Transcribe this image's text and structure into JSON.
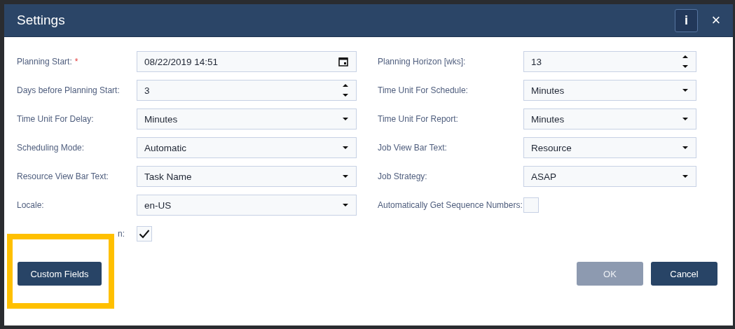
{
  "window": {
    "title": "Settings",
    "info_button": "i",
    "close_button": "×"
  },
  "left_fields": [
    {
      "label": "Planning Start:",
      "required_mark": "*",
      "kind": "date",
      "value": "08/22/2019 14:51"
    },
    {
      "label": "Days before Planning Start:",
      "kind": "number",
      "value": "3"
    },
    {
      "label": "Time Unit For Delay:",
      "kind": "select",
      "value": "Minutes"
    },
    {
      "label": "Scheduling Mode:",
      "kind": "select",
      "value": "Automatic"
    },
    {
      "label": "Resource View Bar Text:",
      "kind": "select",
      "value": "Task Name"
    },
    {
      "label": "Locale:",
      "kind": "select",
      "value": "en-US"
    },
    {
      "label": "n:",
      "kind": "checkbox",
      "checked": true
    }
  ],
  "right_fields": [
    {
      "label": "Planning Horizon [wks]:",
      "kind": "number",
      "value": "13"
    },
    {
      "label": "Time Unit For Schedule:",
      "kind": "select",
      "value": "Minutes"
    },
    {
      "label": "Time Unit For Report:",
      "kind": "select",
      "value": "Minutes"
    },
    {
      "label": "Job View Bar Text:",
      "kind": "select",
      "value": "Resource"
    },
    {
      "label": "Job Strategy:",
      "kind": "select",
      "value": "ASAP"
    },
    {
      "label": "Automatically Get Sequence Numbers:",
      "kind": "checkbox",
      "checked": false
    }
  ],
  "buttons": [
    {
      "label": "Custom Fields",
      "disabled": false
    },
    {
      "label": "OK",
      "disabled": true
    },
    {
      "label": "Cancel",
      "disabled": false
    }
  ]
}
